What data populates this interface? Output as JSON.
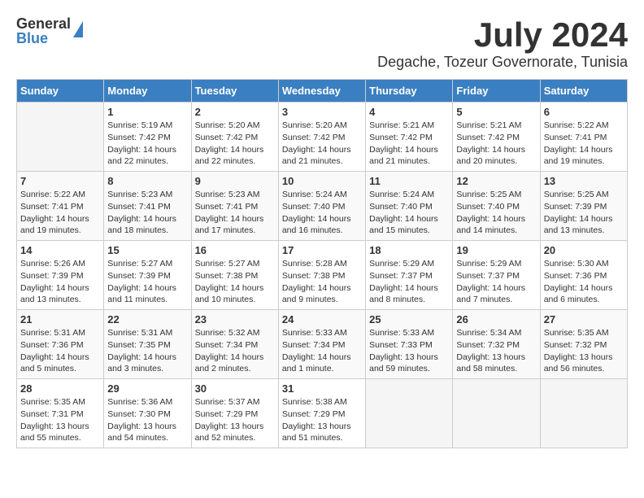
{
  "logo": {
    "general": "General",
    "blue": "Blue"
  },
  "header": {
    "month": "July 2024",
    "location": "Degache, Tozeur Governorate, Tunisia"
  },
  "weekdays": [
    "Sunday",
    "Monday",
    "Tuesday",
    "Wednesday",
    "Thursday",
    "Friday",
    "Saturday"
  ],
  "weeks": [
    [
      {
        "day": "",
        "empty": true
      },
      {
        "day": "1",
        "sunrise": "5:19 AM",
        "sunset": "7:42 PM",
        "daylight": "14 hours and 22 minutes."
      },
      {
        "day": "2",
        "sunrise": "5:20 AM",
        "sunset": "7:42 PM",
        "daylight": "14 hours and 22 minutes."
      },
      {
        "day": "3",
        "sunrise": "5:20 AM",
        "sunset": "7:42 PM",
        "daylight": "14 hours and 21 minutes."
      },
      {
        "day": "4",
        "sunrise": "5:21 AM",
        "sunset": "7:42 PM",
        "daylight": "14 hours and 21 minutes."
      },
      {
        "day": "5",
        "sunrise": "5:21 AM",
        "sunset": "7:42 PM",
        "daylight": "14 hours and 20 minutes."
      },
      {
        "day": "6",
        "sunrise": "5:22 AM",
        "sunset": "7:41 PM",
        "daylight": "14 hours and 19 minutes."
      }
    ],
    [
      {
        "day": "7",
        "sunrise": "5:22 AM",
        "sunset": "7:41 PM",
        "daylight": "14 hours and 19 minutes."
      },
      {
        "day": "8",
        "sunrise": "5:23 AM",
        "sunset": "7:41 PM",
        "daylight": "14 hours and 18 minutes."
      },
      {
        "day": "9",
        "sunrise": "5:23 AM",
        "sunset": "7:41 PM",
        "daylight": "14 hours and 17 minutes."
      },
      {
        "day": "10",
        "sunrise": "5:24 AM",
        "sunset": "7:40 PM",
        "daylight": "14 hours and 16 minutes."
      },
      {
        "day": "11",
        "sunrise": "5:24 AM",
        "sunset": "7:40 PM",
        "daylight": "14 hours and 15 minutes."
      },
      {
        "day": "12",
        "sunrise": "5:25 AM",
        "sunset": "7:40 PM",
        "daylight": "14 hours and 14 minutes."
      },
      {
        "day": "13",
        "sunrise": "5:25 AM",
        "sunset": "7:39 PM",
        "daylight": "14 hours and 13 minutes."
      }
    ],
    [
      {
        "day": "14",
        "sunrise": "5:26 AM",
        "sunset": "7:39 PM",
        "daylight": "14 hours and 13 minutes."
      },
      {
        "day": "15",
        "sunrise": "5:27 AM",
        "sunset": "7:39 PM",
        "daylight": "14 hours and 11 minutes."
      },
      {
        "day": "16",
        "sunrise": "5:27 AM",
        "sunset": "7:38 PM",
        "daylight": "14 hours and 10 minutes."
      },
      {
        "day": "17",
        "sunrise": "5:28 AM",
        "sunset": "7:38 PM",
        "daylight": "14 hours and 9 minutes."
      },
      {
        "day": "18",
        "sunrise": "5:29 AM",
        "sunset": "7:37 PM",
        "daylight": "14 hours and 8 minutes."
      },
      {
        "day": "19",
        "sunrise": "5:29 AM",
        "sunset": "7:37 PM",
        "daylight": "14 hours and 7 minutes."
      },
      {
        "day": "20",
        "sunrise": "5:30 AM",
        "sunset": "7:36 PM",
        "daylight": "14 hours and 6 minutes."
      }
    ],
    [
      {
        "day": "21",
        "sunrise": "5:31 AM",
        "sunset": "7:36 PM",
        "daylight": "14 hours and 5 minutes."
      },
      {
        "day": "22",
        "sunrise": "5:31 AM",
        "sunset": "7:35 PM",
        "daylight": "14 hours and 3 minutes."
      },
      {
        "day": "23",
        "sunrise": "5:32 AM",
        "sunset": "7:34 PM",
        "daylight": "14 hours and 2 minutes."
      },
      {
        "day": "24",
        "sunrise": "5:33 AM",
        "sunset": "7:34 PM",
        "daylight": "14 hours and 1 minute."
      },
      {
        "day": "25",
        "sunrise": "5:33 AM",
        "sunset": "7:33 PM",
        "daylight": "13 hours and 59 minutes."
      },
      {
        "day": "26",
        "sunrise": "5:34 AM",
        "sunset": "7:32 PM",
        "daylight": "13 hours and 58 minutes."
      },
      {
        "day": "27",
        "sunrise": "5:35 AM",
        "sunset": "7:32 PM",
        "daylight": "13 hours and 56 minutes."
      }
    ],
    [
      {
        "day": "28",
        "sunrise": "5:35 AM",
        "sunset": "7:31 PM",
        "daylight": "13 hours and 55 minutes."
      },
      {
        "day": "29",
        "sunrise": "5:36 AM",
        "sunset": "7:30 PM",
        "daylight": "13 hours and 54 minutes."
      },
      {
        "day": "30",
        "sunrise": "5:37 AM",
        "sunset": "7:29 PM",
        "daylight": "13 hours and 52 minutes."
      },
      {
        "day": "31",
        "sunrise": "5:38 AM",
        "sunset": "7:29 PM",
        "daylight": "13 hours and 51 minutes."
      },
      {
        "day": "",
        "empty": true
      },
      {
        "day": "",
        "empty": true
      },
      {
        "day": "",
        "empty": true
      }
    ]
  ]
}
